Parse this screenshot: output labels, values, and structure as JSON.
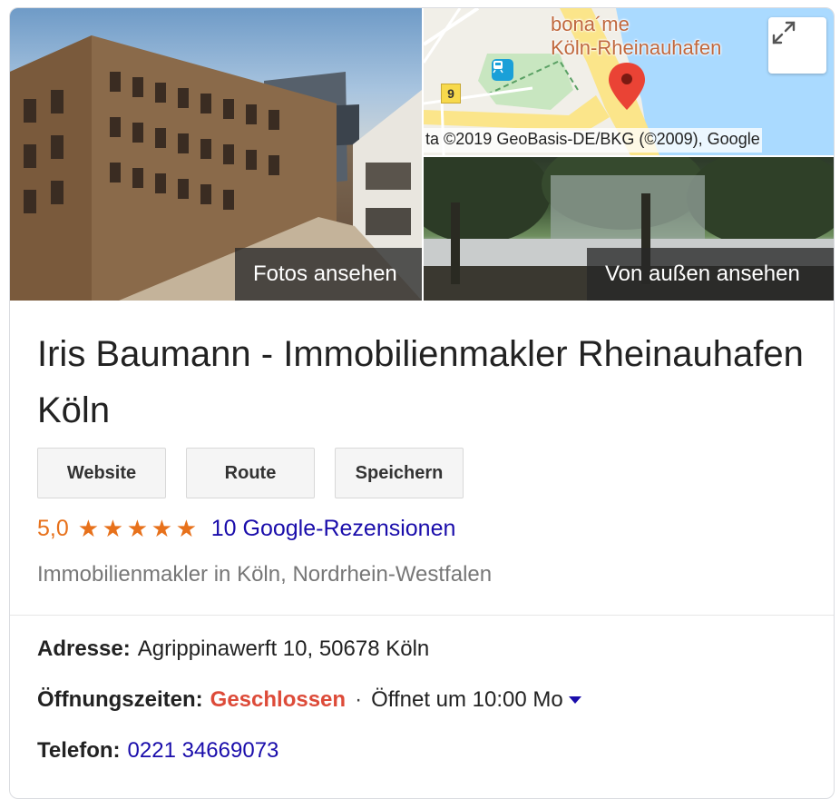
{
  "media": {
    "photos_label": "Fotos ansehen",
    "street_view_label": "Von außen ansehen",
    "map": {
      "place_line1": "bona´me",
      "place_line2": "Köln-Rheinauhafen",
      "attribution": "ta ©2019 GeoBasis-DE/BKG (©2009), Google",
      "road_badge": "9",
      "expand_icon": "expand-icon",
      "pin_icon": "map-pin-icon",
      "tram_icon": "tram-icon"
    }
  },
  "business": {
    "title": "Iris Baumann - Immobilienmakler Rheinauhafen Köln",
    "actions": [
      "Website",
      "Route",
      "Speichern"
    ],
    "rating": "5,0",
    "stars": 5,
    "reviews_label": "10 Google-Rezensionen",
    "category": "Immobilienmakler in Köln, Nordrhein-Westfalen"
  },
  "facts": {
    "address_label": "Adresse:",
    "address_value": "Agrippinawerft 10, 50678 Köln",
    "hours_label": "Öffnungszeiten:",
    "hours_status": "Geschlossen",
    "hours_separator": "·",
    "hours_next": "Öffnet um 10:00 Mo",
    "phone_label": "Telefon:",
    "phone_value": "0221 34669073"
  },
  "colors": {
    "rating": "#e7711b",
    "link": "#1a0dab",
    "closed": "#dd4b39",
    "map_water": "#aadaff",
    "map_pin": "#ea4335"
  }
}
